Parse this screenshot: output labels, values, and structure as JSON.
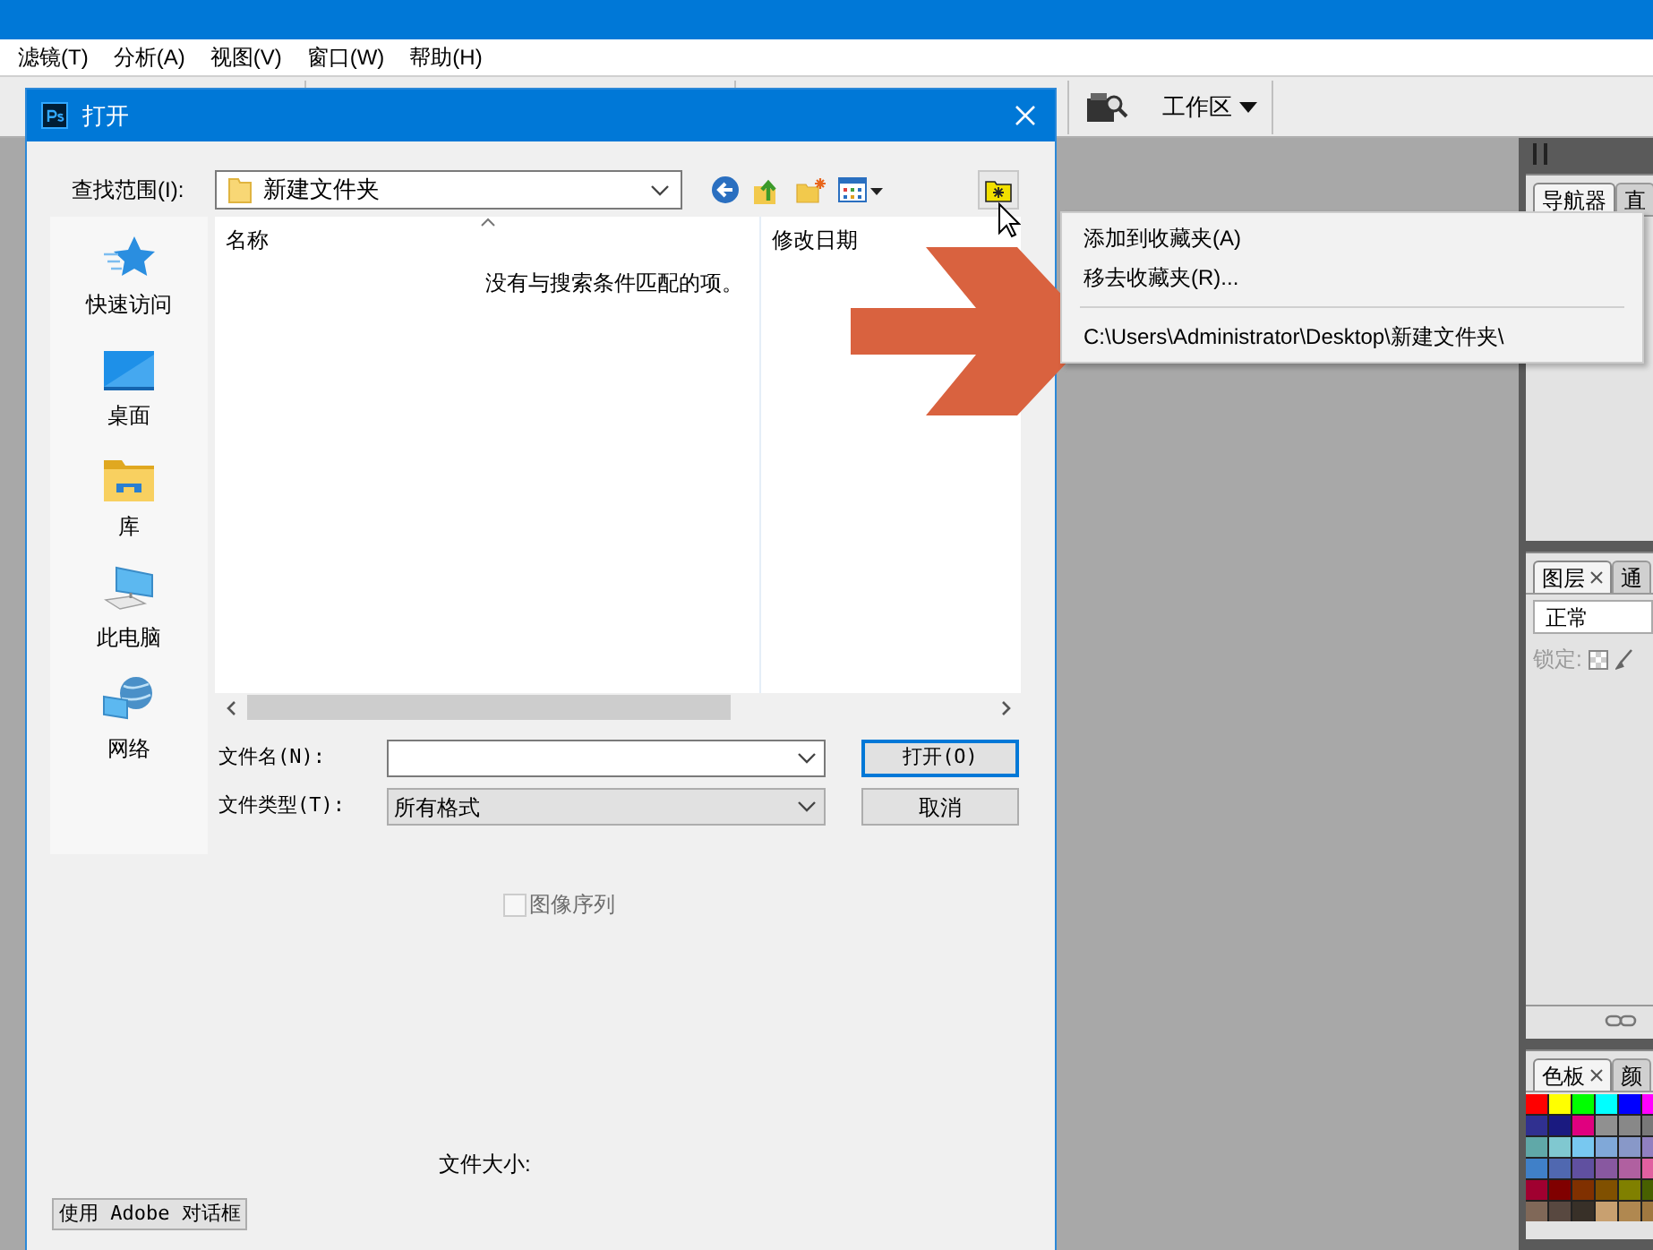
{
  "menu_bar": [
    {
      "label": "滤镜(T)"
    },
    {
      "label": "分析(A)"
    },
    {
      "label": "视图(V)"
    },
    {
      "label": "窗口(W)"
    },
    {
      "label": "帮助(H)"
    }
  ],
  "options_bar": {
    "workspace": "工作区"
  },
  "dialog": {
    "title": "打开",
    "look_in_label": "查找范围(I):",
    "look_in_value": "新建文件夹",
    "places": [
      {
        "label": "快速访问",
        "kind": "star"
      },
      {
        "label": "桌面",
        "kind": "desktop"
      },
      {
        "label": "库",
        "kind": "library"
      },
      {
        "label": "此电脑",
        "kind": "computer"
      },
      {
        "label": "网络",
        "kind": "network"
      }
    ],
    "columns": [
      "名称",
      "修改日期"
    ],
    "empty_message": "没有与搜索条件匹配的项。",
    "file_name_label": "文件名(N):",
    "file_type_label": "文件类型(T):",
    "file_type_value": "所有格式",
    "open_button": "打开(O)",
    "cancel_button": "取消",
    "image_sequence": {
      "label": "图像序列",
      "checked": false,
      "disabled": true
    },
    "file_size_label": "文件大小:",
    "adobe_dialog_button": "使用 Adobe 对话框"
  },
  "favorites_menu": [
    {
      "kind": "command",
      "label": "添加到收藏夹(A)"
    },
    {
      "kind": "command",
      "label": "移去收藏夹(R)..."
    },
    {
      "kind": "separator"
    },
    {
      "kind": "command",
      "label": "C:\\Users\\Administrator\\Desktop\\新建文件夹\\"
    }
  ],
  "panels": [
    {
      "kind": "navigator",
      "tabs": [
        {
          "label": "导航器",
          "selected": true
        },
        {
          "label": "直",
          "selected": false
        }
      ]
    },
    {
      "kind": "layers",
      "tabs": [
        {
          "label": "图层",
          "selected": true
        },
        {
          "label": "通",
          "selected": false
        }
      ],
      "blend_mode": "正常",
      "lock_label": "锁定:"
    },
    {
      "kind": "swatches",
      "tabs": [
        {
          "label": "色板",
          "selected": true
        },
        {
          "label": "颜",
          "selected": false
        }
      ],
      "swatches": [
        {
          "color": "#ff0000"
        },
        {
          "color": "#ffff00"
        },
        {
          "color": "#00ff00"
        },
        {
          "color": "#00ffff"
        },
        {
          "color": "#0000ff"
        },
        {
          "color": "#ff00ff"
        },
        {
          "color": "#303090"
        },
        {
          "color": "#1a1a80"
        },
        {
          "color": "#e0007f"
        },
        {
          "color": "#909090"
        },
        {
          "color": "#888888"
        },
        {
          "color": "#787878"
        },
        {
          "color": "#60a8a8"
        },
        {
          "color": "#80c8d0"
        },
        {
          "color": "#78c8f0"
        },
        {
          "color": "#80a8d8"
        },
        {
          "color": "#8898c8"
        },
        {
          "color": "#9080c0"
        },
        {
          "color": "#4080c8"
        },
        {
          "color": "#5068b0"
        },
        {
          "color": "#6050a0"
        },
        {
          "color": "#8858a0"
        },
        {
          "color": "#b060a0"
        },
        {
          "color": "#e060a0"
        },
        {
          "color": "#a00030"
        },
        {
          "color": "#800000"
        },
        {
          "color": "#803000"
        },
        {
          "color": "#805000"
        },
        {
          "color": "#808000"
        },
        {
          "color": "#486000"
        },
        {
          "color": "#806858"
        },
        {
          "color": "#584840"
        },
        {
          "color": "#383028"
        },
        {
          "color": "#c8a070"
        },
        {
          "color": "#b08850"
        },
        {
          "color": "#a07840"
        }
      ]
    }
  ]
}
